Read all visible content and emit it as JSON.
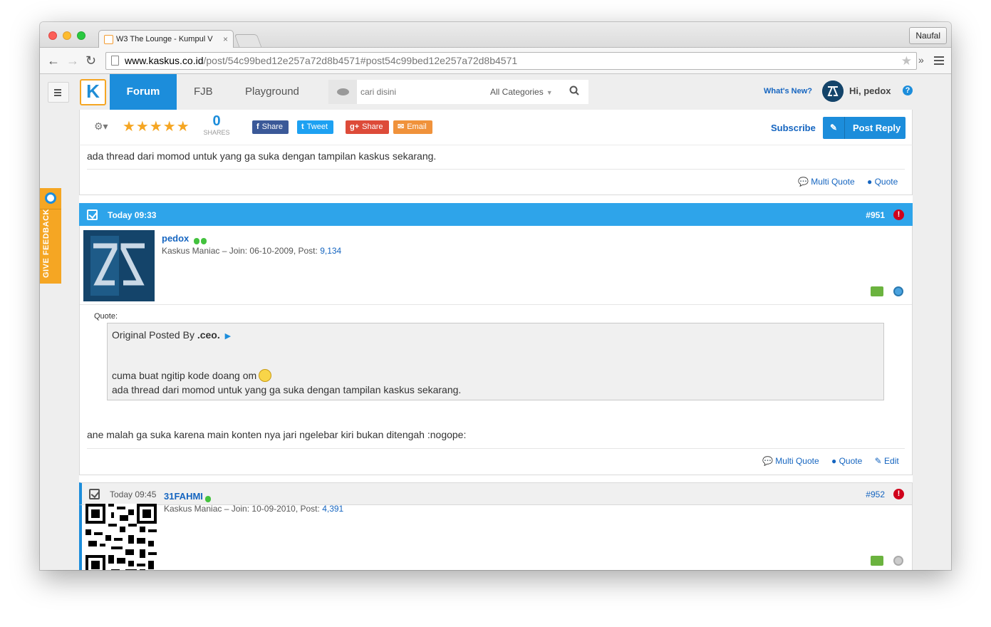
{
  "browser": {
    "tab_title": "W3 The Lounge - Kumpul V",
    "profile_name": "Naufal",
    "url_domain": "www.kaskus.co.id",
    "url_path": "/post/54c99bed12e257a72d8b4571#post54c99bed12e257a72d8b4571",
    "more_label": "»"
  },
  "nav": {
    "logo": "K",
    "tabs": [
      "Forum",
      "FJB",
      "Playground"
    ],
    "search_placeholder": "cari disini",
    "category": "All Categories",
    "whats_new": "What's New?",
    "greeting": "Hi, pedox",
    "help": "?"
  },
  "feedback": {
    "label": "GIVE FEEDBACK"
  },
  "postbar": {
    "rating_stars": 5,
    "stars_text": "★★★★★",
    "shares_count": "0",
    "shares_label": "SHARES",
    "buttons": [
      {
        "icon": "f",
        "label": "Share",
        "color": "#3b5998"
      },
      {
        "icon": "t",
        "label": "Tweet",
        "color": "#1da1f2"
      },
      {
        "icon": "g+",
        "label": "Share",
        "color": "#dd4b39"
      },
      {
        "icon": "✉",
        "label": "Email",
        "color": "#f0923b"
      }
    ],
    "subscribe": "Subscribe",
    "post_reply": "Post Reply"
  },
  "prev_post": {
    "text": "ada thread dari momod untuk yang ga suka dengan tampilan kaskus sekarang.",
    "multi_quote": "Multi Quote",
    "quote": "Quote"
  },
  "posts": [
    {
      "time": "Today 09:33",
      "number": "#951",
      "username": "pedox",
      "rank": "Kaskus Maniac",
      "join_label": "Join:",
      "join_date": "06-10-2009",
      "post_label": "Post:",
      "post_count": "9,134",
      "quote_label": "Quote:",
      "quote_origin_prefix": "Original Posted By",
      "quote_author": ".ceo.",
      "quote_arrow": "▶",
      "quote_line1": "cuma buat ngitip kode doang om",
      "quote_line2": "ada thread dari momod untuk yang ga suka dengan tampilan kaskus sekarang.",
      "body": "ane malah ga suka karena main konten nya jari ngelebar kiri bukan ditengah :nogope:",
      "multi_quote": "Multi Quote",
      "quote": "Quote",
      "edit": "Edit"
    },
    {
      "time": "Today 09:45",
      "number": "#952",
      "username": "31FAHMI",
      "rank": "Kaskus Maniac",
      "join_label": "Join:",
      "join_date": "10-09-2010",
      "post_label": "Post:",
      "post_count": "4,391"
    }
  ]
}
